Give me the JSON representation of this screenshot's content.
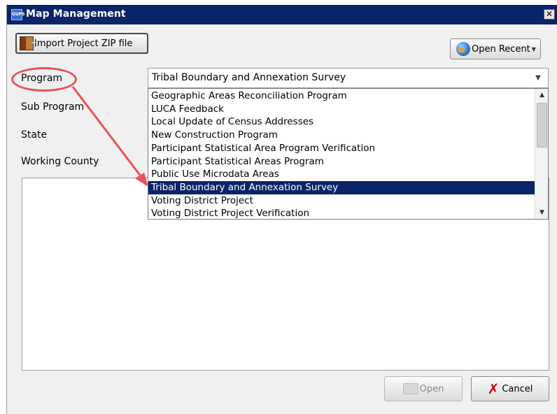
{
  "window": {
    "title": "Map Management",
    "app_icon_text": "GUPS",
    "close_label": "✕"
  },
  "toolbar": {
    "import_label": "Import Project ZIP file",
    "open_recent_label": "Open Recent"
  },
  "form": {
    "labels": {
      "program": "Program",
      "sub_program": "Sub Program",
      "state": "State",
      "working_county": "Working County"
    },
    "program_selected": "Tribal Boundary and Annexation Survey",
    "program_options": [
      "Geographic Areas Reconciliation Program",
      "LUCA Feedback",
      "Local Update of Census Addresses",
      "New Construction Program",
      "Participant Statistical Area Program Verification",
      "Participant Statistical Areas Program",
      "Public Use Microdata Areas",
      "Tribal Boundary and Annexation Survey",
      "Voting District Project",
      "Voting District Project Verification"
    ]
  },
  "footer": {
    "open_label": "Open",
    "cancel_label": "Cancel"
  },
  "colors": {
    "titlebar": "#0a246a",
    "selection": "#0a246a",
    "annotation": "#e8515c"
  },
  "icons": {
    "import": "zip-archive-icon",
    "open_recent": "globe-icon",
    "open": "folder-icon",
    "cancel": "red-x-icon"
  }
}
